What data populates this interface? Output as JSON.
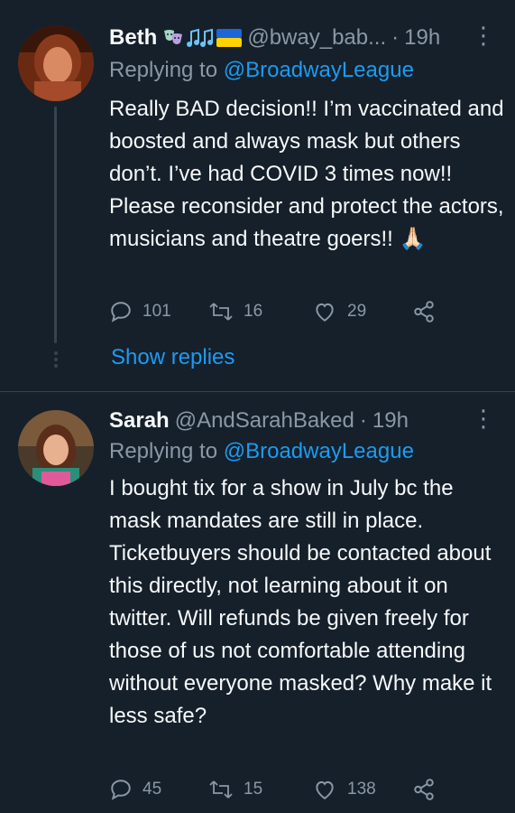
{
  "tweets": [
    {
      "name": "Beth",
      "badges": [
        "performing-arts-masks-icon",
        "musical-notes-icon",
        "ukraine-flag-icon"
      ],
      "handle": "@bway_bab...",
      "dot": "·",
      "time": "19h",
      "replying_prefix": "Replying to",
      "replying_to": "@BroadwayLeague",
      "text": "Really BAD decision!!  I’m vaccinated and boosted and always mask but others don’t. I’ve had COVID 3 times now!!  Please reconsider and protect the actors, musicians and theatre goers!! 🙏🏻",
      "replies": "101",
      "retweets": "16",
      "likes": "29"
    },
    {
      "name": "Sarah",
      "handle": "@AndSarahBaked",
      "dot": "·",
      "time": "19h",
      "replying_prefix": "Replying to",
      "replying_to": "@BroadwayLeague",
      "text": "I bought tix for a show in July bc the mask mandates are still in place. Ticketbuyers should be contacted about this directly, not learning about it on twitter. Will refunds be given freely for those of us not comfortable attending without everyone masked? Why make it less safe?",
      "replies": "45",
      "retweets": "15",
      "likes": "138"
    }
  ],
  "show_replies": "Show replies",
  "colors": {
    "background": "#15202b",
    "accent": "#1d9bf0",
    "muted": "#8b98a5",
    "divider": "#38444d"
  }
}
